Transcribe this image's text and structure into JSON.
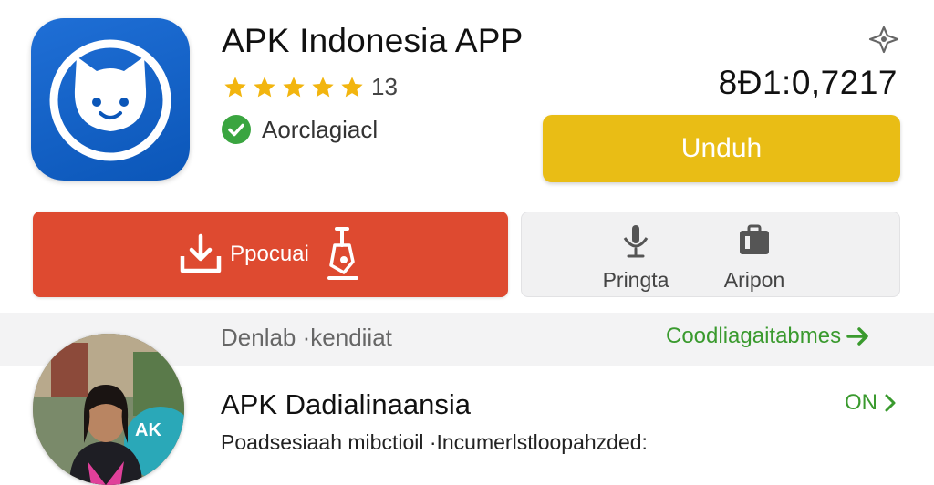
{
  "app": {
    "title": "APK Indonesia  APP",
    "rating_count": "13",
    "verified_label": "Aorclagiacl",
    "counter": "8Ð1:0,7217"
  },
  "buttons": {
    "unduh": "Unduh",
    "primary": "Ppocuai",
    "pringta": "Pringta",
    "aripon": "Aripon"
  },
  "section": {
    "title": "Denlab ·kendiiat",
    "link": "Coodliagaitabmes"
  },
  "list_item": {
    "title": "APK Dadialinaansia",
    "status": "ON",
    "description": "Poadsesiaah mibctioil ·Incumerlstloopahzded:",
    "avatar_badge": "AK"
  },
  "colors": {
    "icon_blue": "#0b56b8",
    "accent_yellow": "#e9bd15",
    "accent_red": "#de4a30",
    "accent_green": "#3a9a2e",
    "star": "#f2b50f"
  },
  "icons": {
    "app": "cat-face-icon",
    "share": "share-icon",
    "verified": "check-circle-icon",
    "download": "download-tray-icon",
    "tool": "tool-icon",
    "mic": "microphone-icon",
    "suitcase": "briefcase-icon"
  },
  "rating_stars": 5
}
